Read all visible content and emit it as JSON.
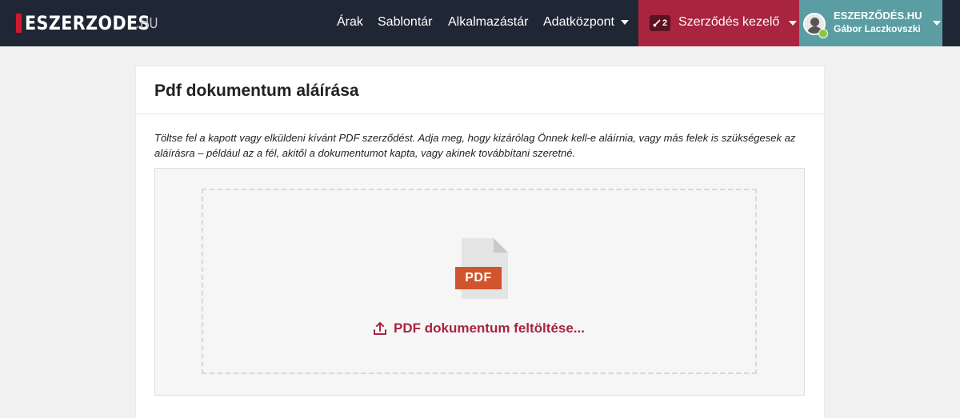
{
  "brand": {
    "name": "ESZERZODES",
    "tld": ".HU"
  },
  "nav": {
    "links": [
      {
        "label": "Árak"
      },
      {
        "label": "Sablontár"
      },
      {
        "label": "Alkalmazástár"
      },
      {
        "label": "Adatközpont"
      }
    ]
  },
  "contract_manager": {
    "badge": "2",
    "label": "Szerződés kezelő"
  },
  "user": {
    "org": "ESZERZŐDÉS.HU",
    "name": "Gábor Laczkovszki"
  },
  "page": {
    "title": "Pdf dokumentum aláírása",
    "intro": "Töltse fel a kapott vagy elküldeni kívánt PDF szerződést. Adja meg, hogy kizárólag Önnek kell-e aláírnia, vagy más felek is szükségesek az aláírásra – például az a fél, akitől a dokumentumot kapta, vagy akinek továbbítani szeretné.",
    "file_type_label": "PDF",
    "upload_label": "PDF dokumentum feltöltése..."
  },
  "colors": {
    "accent": "#a8243f",
    "navbar": "#1f2634",
    "user_area": "#5a9ea4",
    "pdf_badge": "#d0542d"
  }
}
